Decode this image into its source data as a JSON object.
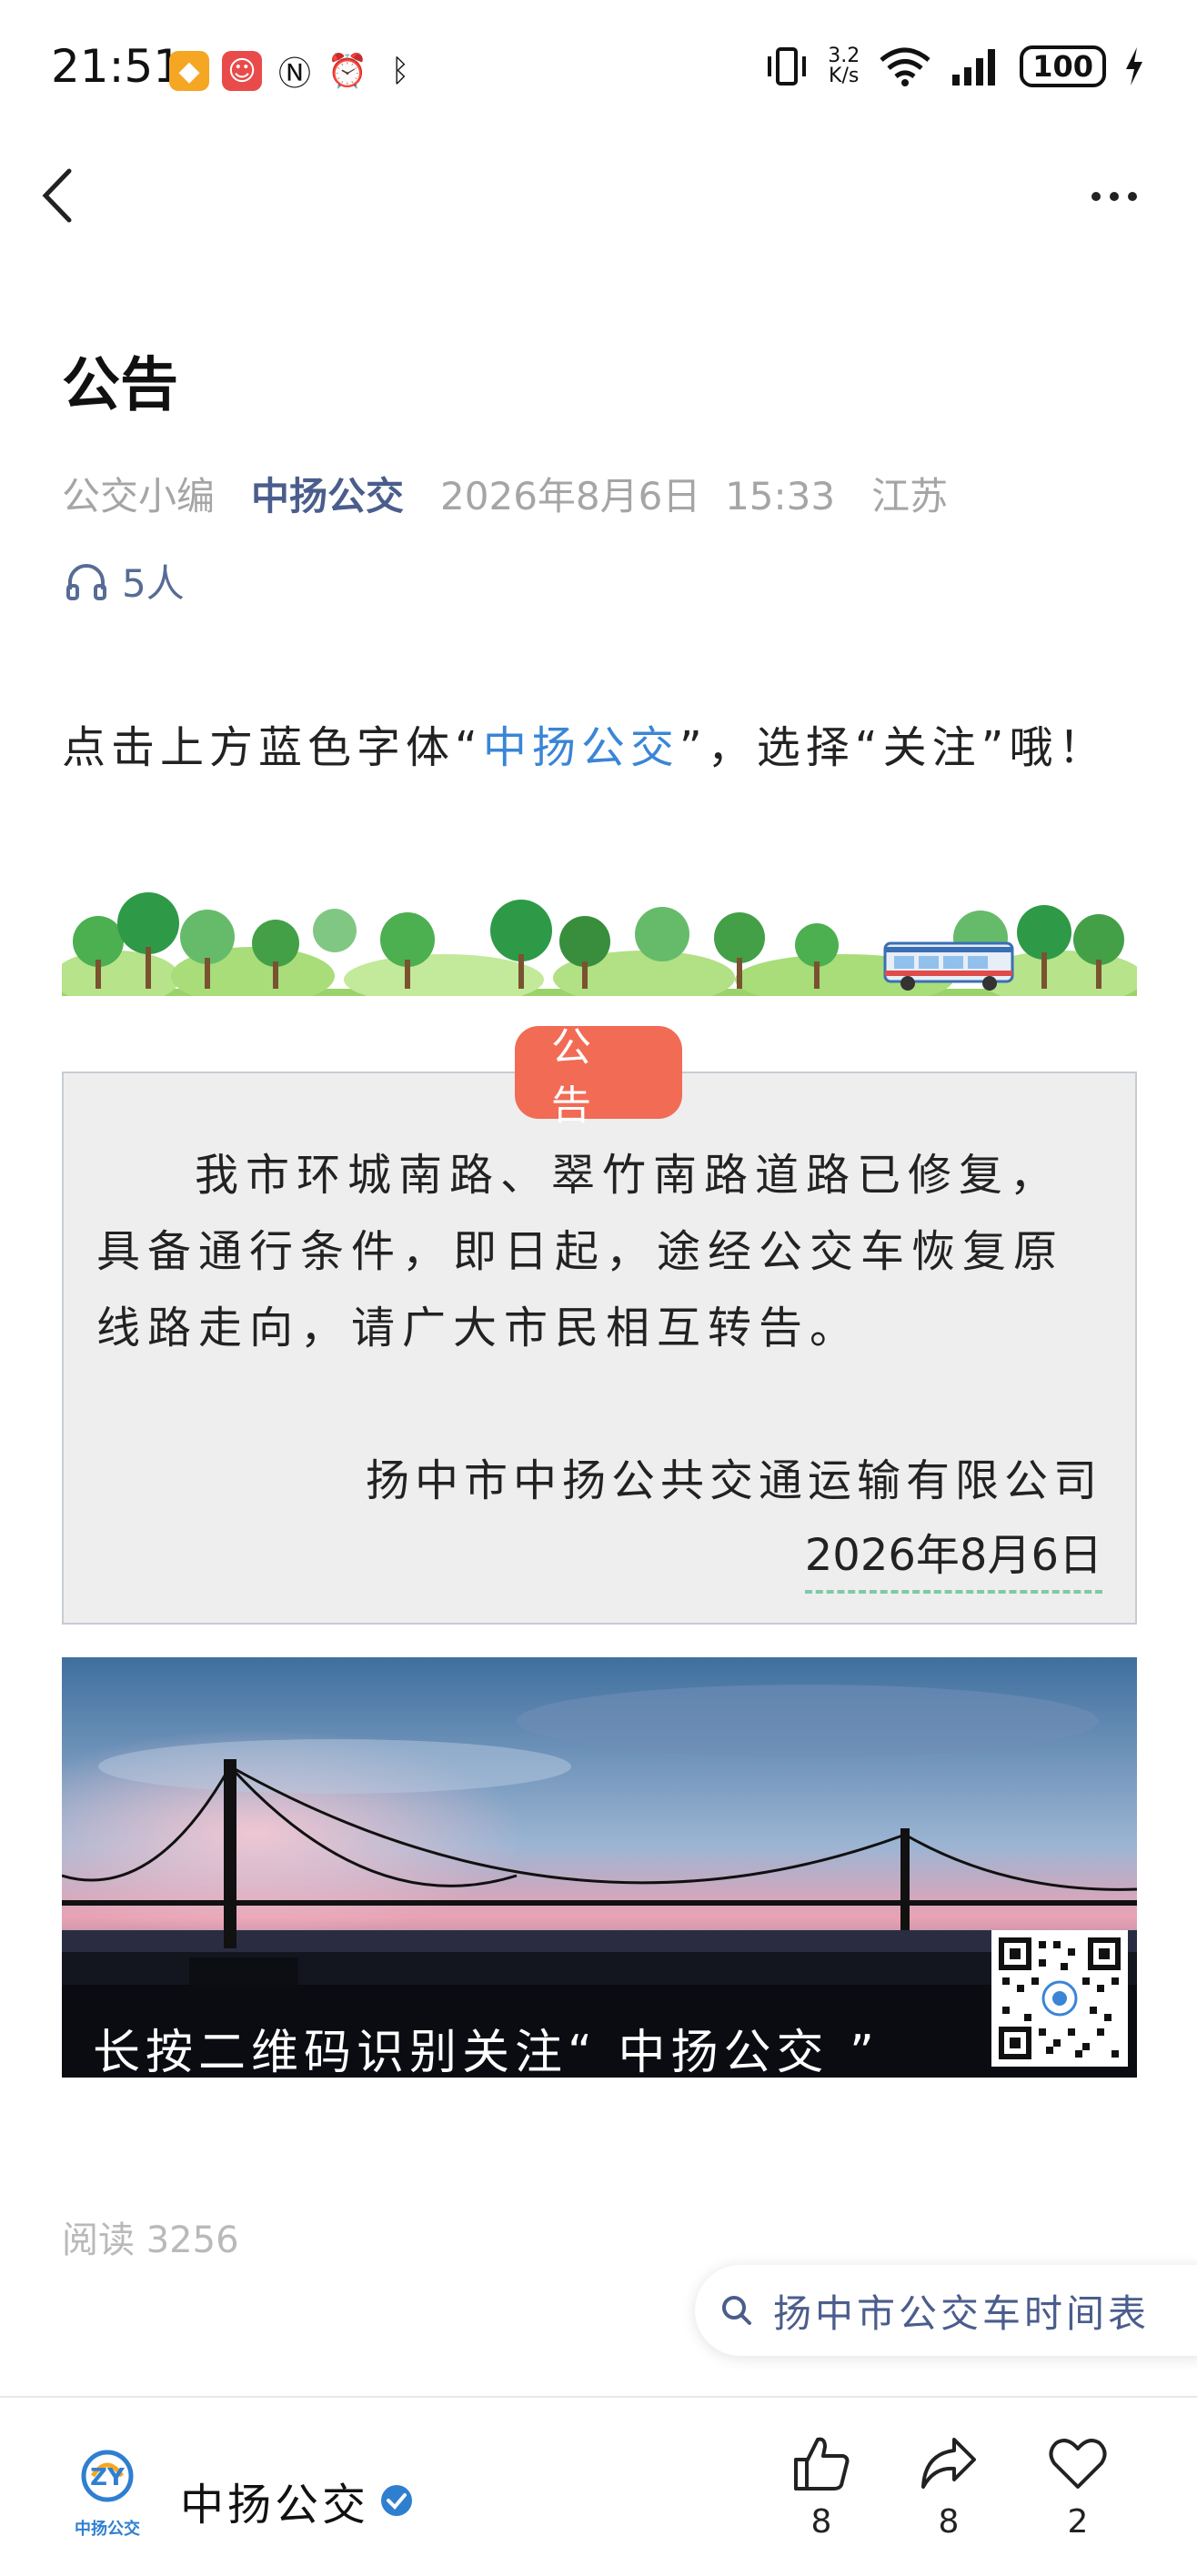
{
  "status_bar": {
    "time": "21:51",
    "speed_value": "3.2",
    "speed_unit": "K/s",
    "battery": "100"
  },
  "article": {
    "title": "公告",
    "author": "公交小编",
    "account": "中扬公交",
    "date": "2026年8月6日",
    "time": "15:33",
    "location": "江苏",
    "listeners": "5人",
    "intro_prefix": "点击上方蓝色字体“",
    "intro_link": "中扬公交",
    "intro_suffix": "”，选择“关注”哦！"
  },
  "announcement": {
    "tag": "公告",
    "body": "我市环城南路、翠竹南路道路已修复，具备通行条件，即日起，途经公交车恢复原线路走向，请广大市民相互转告。",
    "company": "扬中市中扬公共交通运输有限公司",
    "date": "2026年8月6日"
  },
  "image": {
    "caption": "长按二维码识别关注“ 中扬公交 ”"
  },
  "footer": {
    "read_label": "阅读",
    "read_count": "3256",
    "search_tag": "扬中市公交车时间表"
  },
  "bottom_bar": {
    "account_name": "中扬公交",
    "logo_text": "中扬公交",
    "like_count": "8",
    "share_count": "8",
    "favorite_count": "2"
  },
  "colors": {
    "accent_blue": "#3a85d6",
    "account_blue": "#4a5d8c",
    "tag_red": "#f26b55"
  }
}
